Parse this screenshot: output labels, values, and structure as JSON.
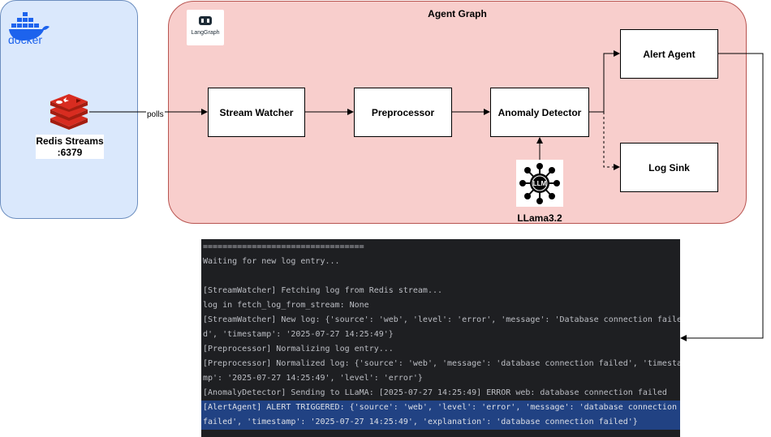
{
  "docker": {
    "logo_text": "docker"
  },
  "redis": {
    "label_line1": "Redis Streams",
    "label_line2": ":6379"
  },
  "graph": {
    "title": "Agent Graph",
    "langgraph_logo_text": "LangGraph",
    "nodes": {
      "stream_watcher": "Stream Watcher",
      "preprocessor": "Preprocessor",
      "anomaly_detector": "Anomaly Detector",
      "alert_agent": "Alert Agent",
      "log_sink": "Log Sink"
    },
    "llm_label": "LLama3.2",
    "llm_icon_text": "LLM"
  },
  "edges": {
    "polls_label": "polls"
  },
  "terminal": {
    "lines": [
      "=================================",
      "Waiting for new log entry...",
      "",
      "[StreamWatcher] Fetching log from Redis stream...",
      "log in fetch_log_from_stream: None",
      "[StreamWatcher] New log: {'source': 'web', 'level': 'error', 'message': 'Database connection faile",
      "d', 'timestamp': '2025-07-27 14:25:49'}",
      "[Preprocessor] Normalizing log entry...",
      "[Preprocessor] Normalized log: {'source': 'web', 'message': 'database connection failed', 'timesta",
      "mp': '2025-07-27 14:25:49', 'level': 'error'}",
      "[AnomalyDetector] Sending to LLaMA: [2025-07-27 14:25:49] ERROR web: database connection failed",
      "[AlertAgent] ALERT TRIGGERED: {'source': 'web', 'level': 'error', 'message': 'database connection",
      "failed', 'timestamp': '2025-07-27 14:25:49', 'explanation': 'database connection failed'}"
    ]
  },
  "colors": {
    "docker_panel_fill": "#dae8fc",
    "graph_panel_fill": "#f8cecc",
    "redis_red": "#d82c20",
    "docker_blue": "#1d63ed",
    "terminal_bg": "#1e1f22",
    "terminal_highlight": "#214283"
  }
}
